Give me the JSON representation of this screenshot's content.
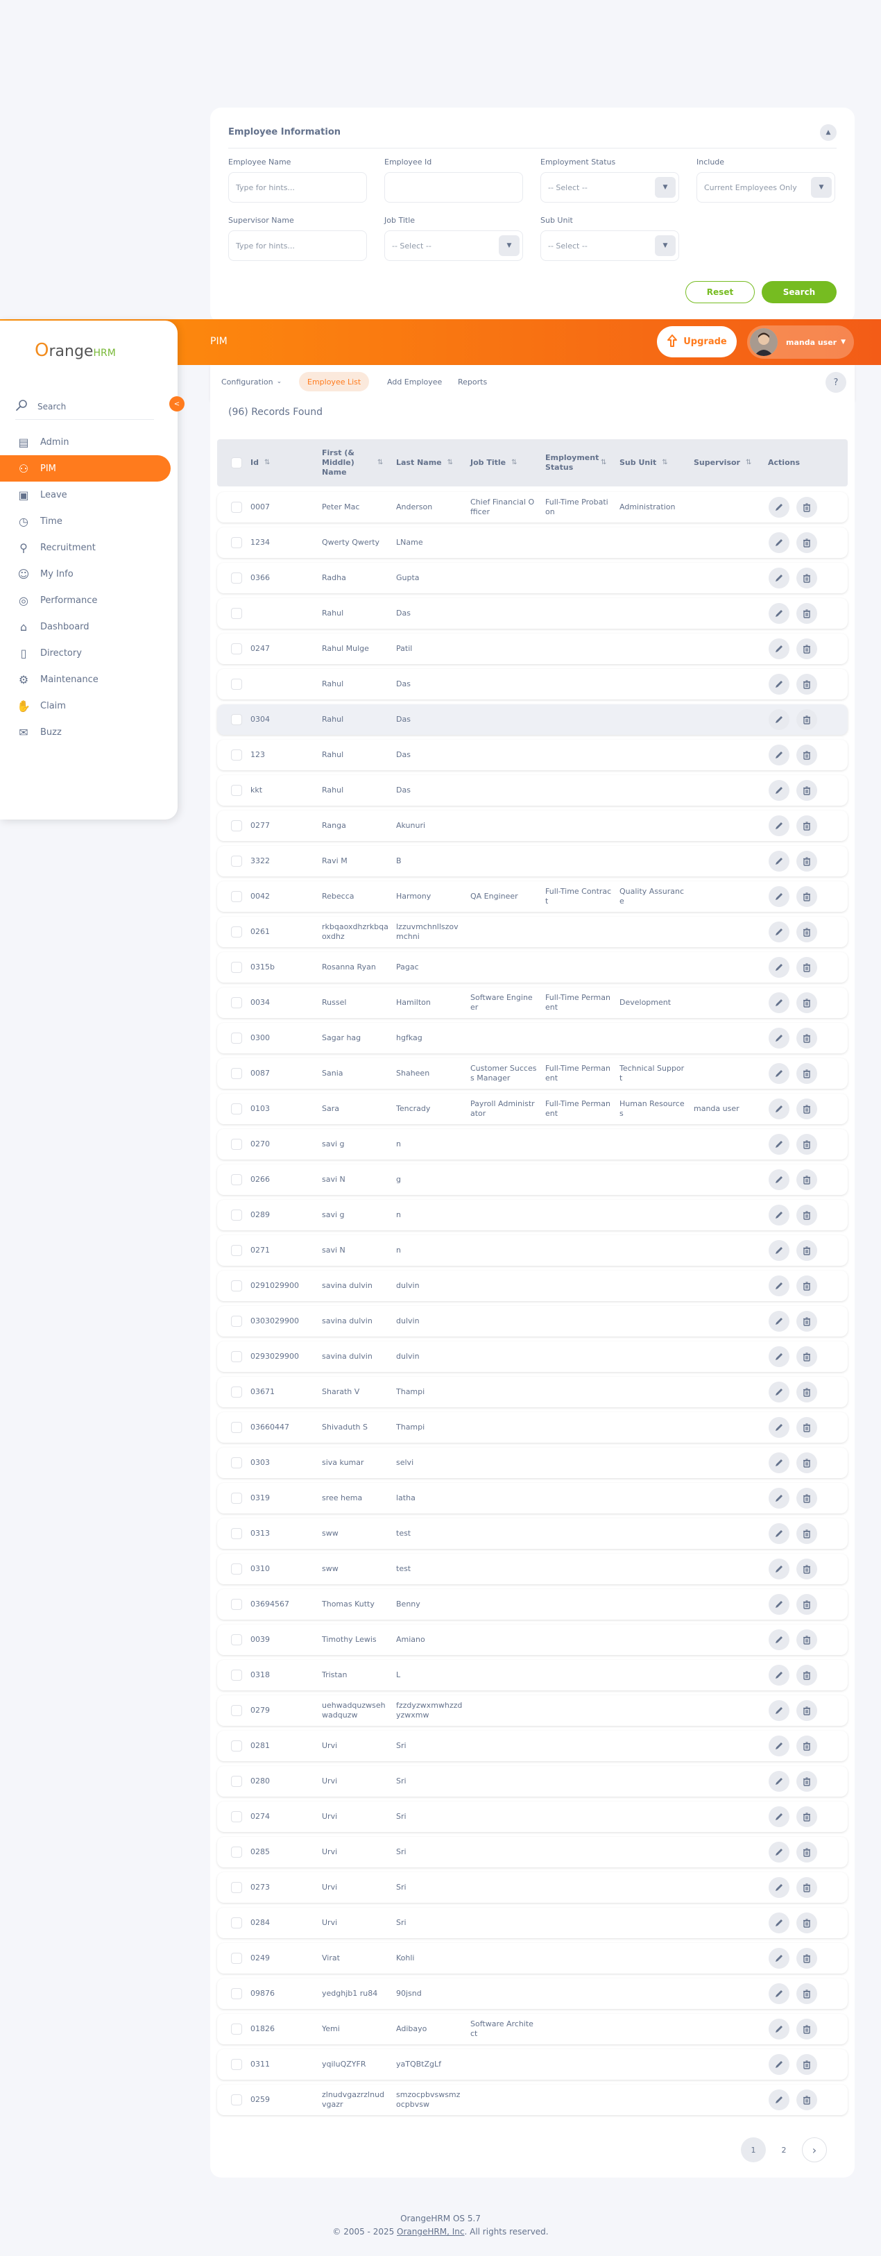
{
  "filter": {
    "title": "Employee Information",
    "toggle_icon": "chevron-up-icon",
    "fields": [
      {
        "label": "Employee Name",
        "type": "text",
        "placeholder": "Type for hints..."
      },
      {
        "label": "Employee Id",
        "type": "text",
        "placeholder": ""
      },
      {
        "label": "Employment Status",
        "type": "select",
        "value": "-- Select --"
      },
      {
        "label": "Include",
        "type": "select",
        "value": "Current Employees Only"
      },
      {
        "label": "Supervisor Name",
        "type": "text",
        "placeholder": "Type for hints..."
      },
      {
        "label": "Job Title",
        "type": "select",
        "value": "-- Select --"
      },
      {
        "label": "Sub Unit",
        "type": "select",
        "value": "-- Select --"
      }
    ],
    "reset_label": "Reset",
    "search_label": "Search"
  },
  "topbar": {
    "module": "PIM",
    "upgrade_label": "Upgrade",
    "user_name": "manda user"
  },
  "tabs": [
    {
      "label": "Configuration",
      "dropdown": true,
      "active": false
    },
    {
      "label": "Employee List",
      "active": true
    },
    {
      "label": "Add Employee",
      "active": false
    },
    {
      "label": "Reports",
      "active": false
    }
  ],
  "help_label": "?",
  "sidebar": {
    "logo_o": "O",
    "logo_text": "range",
    "logo_hrm": "HRM",
    "search_placeholder": "Search",
    "items": [
      {
        "label": "Admin",
        "icon": "admin-icon"
      },
      {
        "label": "PIM",
        "icon": "pim-icon",
        "active": true
      },
      {
        "label": "Leave",
        "icon": "leave-icon"
      },
      {
        "label": "Time",
        "icon": "time-icon"
      },
      {
        "label": "Recruitment",
        "icon": "recruitment-icon"
      },
      {
        "label": "My Info",
        "icon": "my-info-icon"
      },
      {
        "label": "Performance",
        "icon": "performance-icon"
      },
      {
        "label": "Dashboard",
        "icon": "dashboard-icon"
      },
      {
        "label": "Directory",
        "icon": "directory-icon"
      },
      {
        "label": "Maintenance",
        "icon": "maintenance-icon"
      },
      {
        "label": "Claim",
        "icon": "claim-icon"
      },
      {
        "label": "Buzz",
        "icon": "buzz-icon"
      }
    ]
  },
  "list": {
    "records_found": "(96) Records Found",
    "columns": [
      {
        "label": "Id",
        "sortable": true
      },
      {
        "label": "First (& Middle) Name",
        "sortable": true
      },
      {
        "label": "Last Name",
        "sortable": true
      },
      {
        "label": "Job Title",
        "sortable": true
      },
      {
        "label": "Employment Status",
        "sortable": true
      },
      {
        "label": "Sub Unit",
        "sortable": true
      },
      {
        "label": "Supervisor",
        "sortable": true
      },
      {
        "label": "Actions",
        "sortable": false
      }
    ],
    "rows": [
      [
        "0007",
        "Peter Mac",
        "Anderson",
        "Chief Financial Officer",
        "Full-Time Probation",
        "Administration",
        ""
      ],
      [
        "1234",
        "Qwerty Qwerty",
        "LName",
        "",
        "",
        "",
        ""
      ],
      [
        "0366",
        "Radha",
        "Gupta",
        "",
        "",
        "",
        ""
      ],
      [
        "",
        "Rahul",
        "Das",
        "",
        "",
        "",
        ""
      ],
      [
        "0247",
        "Rahul Mulge",
        "Patil",
        "",
        "",
        "",
        ""
      ],
      [
        "",
        "Rahul",
        "Das",
        "",
        "",
        "",
        ""
      ],
      [
        "0304",
        "Rahul",
        "Das",
        "",
        "",
        "",
        ""
      ],
      [
        "123",
        "Rahul",
        "Das",
        "",
        "",
        "",
        ""
      ],
      [
        "kkt",
        "Rahul",
        "Das",
        "",
        "",
        "",
        ""
      ],
      [
        "0277",
        "Ranga",
        "Akunuri",
        "",
        "",
        "",
        ""
      ],
      [
        "3322",
        "Ravi M",
        "B",
        "",
        "",
        "",
        ""
      ],
      [
        "0042",
        "Rebecca",
        "Harmony",
        "QA Engineer",
        "Full-Time Contract",
        "Quality Assurance",
        ""
      ],
      [
        "0261",
        "rkbqaoxdhzrkbqaoxdhz",
        "lzzuvmchnllszovmchni",
        "",
        "",
        "",
        ""
      ],
      [
        "0315b",
        "Rosanna Ryan",
        "Pagac",
        "",
        "",
        "",
        ""
      ],
      [
        "0034",
        "Russel",
        "Hamilton",
        "Software Engineer",
        "Full-Time Permanent",
        "Development",
        ""
      ],
      [
        "0300",
        "Sagar hag",
        "hgfkag",
        "",
        "",
        "",
        ""
      ],
      [
        "0087",
        "Sania",
        "Shaheen",
        "Customer Success Manager",
        "Full-Time Permanent",
        "Technical Support",
        ""
      ],
      [
        "0103",
        "Sara",
        "Tencrady",
        "Payroll Administrator",
        "Full-Time Permanent",
        "Human Resources",
        "manda user"
      ],
      [
        "0270",
        "savi g",
        "n",
        "",
        "",
        "",
        ""
      ],
      [
        "0266",
        "savi N",
        "g",
        "",
        "",
        "",
        ""
      ],
      [
        "0289",
        "savi g",
        "n",
        "",
        "",
        "",
        ""
      ],
      [
        "0271",
        "savi N",
        "n",
        "",
        "",
        "",
        ""
      ],
      [
        "0291029900",
        "savina dulvin",
        "dulvin",
        "",
        "",
        "",
        ""
      ],
      [
        "0303029900",
        "savina dulvin",
        "dulvin",
        "",
        "",
        "",
        ""
      ],
      [
        "0293029900",
        "savina dulvin",
        "dulvin",
        "",
        "",
        "",
        ""
      ],
      [
        "03671",
        "Sharath V",
        "Thampi",
        "",
        "",
        "",
        ""
      ],
      [
        "03660447",
        "Shivaduth S",
        "Thampi",
        "",
        "",
        "",
        ""
      ],
      [
        "0303",
        "siva kumar",
        "selvi",
        "",
        "",
        "",
        ""
      ],
      [
        "0319",
        "sree hema",
        "latha",
        "",
        "",
        "",
        ""
      ],
      [
        "0313",
        "sww",
        "test",
        "",
        "",
        "",
        ""
      ],
      [
        "0310",
        "sww",
        "test",
        "",
        "",
        "",
        ""
      ],
      [
        "03694567",
        "Thomas Kutty",
        "Benny",
        "",
        "",
        "",
        ""
      ],
      [
        "0039",
        "Timothy Lewis",
        "Amiano",
        "",
        "",
        "",
        ""
      ],
      [
        "0318",
        "Tristan",
        "L",
        "",
        "",
        "",
        ""
      ],
      [
        "0279",
        "uehwadquzwsehwadquzw",
        "fzzdyzwxmwhzzdyzwxmw",
        "",
        "",
        "",
        ""
      ],
      [
        "0281",
        "Urvi",
        "Sri",
        "",
        "",
        "",
        ""
      ],
      [
        "0280",
        "Urvi",
        "Sri",
        "",
        "",
        "",
        ""
      ],
      [
        "0274",
        "Urvi",
        "Sri",
        "",
        "",
        "",
        ""
      ],
      [
        "0285",
        "Urvi",
        "Sri",
        "",
        "",
        "",
        ""
      ],
      [
        "0273",
        "Urvi",
        "Sri",
        "",
        "",
        "",
        ""
      ],
      [
        "0284",
        "Urvi",
        "Sri",
        "",
        "",
        "",
        ""
      ],
      [
        "0249",
        "Virat",
        "Kohli",
        "",
        "",
        "",
        ""
      ],
      [
        "09876",
        "yedghjb1 ru84",
        "90jsnd",
        "",
        "",
        "",
        ""
      ],
      [
        "01826",
        "Yemi",
        "Adibayo",
        "Software Architect",
        "",
        "",
        ""
      ],
      [
        "0311",
        "yqiluQZYFR",
        "yaTQBtZgLf",
        "",
        "",
        "",
        ""
      ],
      [
        "0259",
        "zlnudvgazrzlnudvgazr",
        "smzocpbvswsmzocpbvsw",
        "",
        "",
        "",
        ""
      ]
    ],
    "highlighted_row": 6,
    "edit_icon": "pencil-icon",
    "delete_icon": "trash-icon",
    "pages": [
      "1",
      "2"
    ],
    "current_page": "1",
    "next_icon": "chevron-right-icon"
  },
  "footer": {
    "version": "OrangeHRM OS 5.7",
    "copyright_prefix": "© 2005 - 2025 ",
    "company_link": "OrangeHRM, Inc",
    "copyright_suffix": ". All rights reserved."
  }
}
